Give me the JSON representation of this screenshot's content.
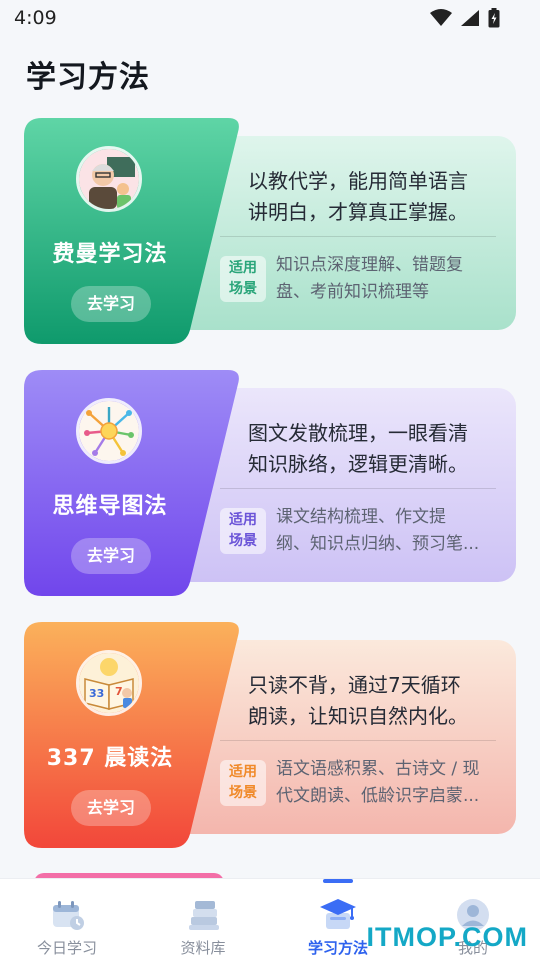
{
  "status_bar": {
    "time": "4:09"
  },
  "page": {
    "title": "学习方法"
  },
  "methods": [
    {
      "name": "费曼学习法",
      "button": "去学习",
      "desc_line1": "以教代学，能用简单语言",
      "desc_line2": "讲明白，才算真正掌握。",
      "scene_badge_1": "适用",
      "scene_badge_2": "场景",
      "scene_line1": "知识点深度理解、错题复",
      "scene_line2": "盘、考前知识梳理等",
      "accent": "#1aa77a"
    },
    {
      "name": "思维导图法",
      "button": "去学习",
      "desc_line1": "图文发散梳理，一眼看清",
      "desc_line2": "知识脉络，逻辑更清晰。",
      "scene_badge_1": "适用",
      "scene_badge_2": "场景",
      "scene_line1": "课文结构梳理、作文提",
      "scene_line2": "纲、知识点归纳、预习笔...",
      "accent": "#7b5cf0"
    },
    {
      "name": "337 晨读法",
      "button": "去学习",
      "desc_line1": "只读不背，通过7天循环",
      "desc_line2": "朗读，让知识自然内化。",
      "scene_badge_1": "适用",
      "scene_badge_2": "场景",
      "scene_line1": "语文语感积累、古诗文 / 现",
      "scene_line2": "代文朗读、低龄识字启蒙...",
      "accent": "#f26a3d"
    }
  ],
  "bottom_nav": [
    {
      "label": "今日学习",
      "icon": "calendar-icon",
      "active": false
    },
    {
      "label": "资料库",
      "icon": "books-icon",
      "active": false
    },
    {
      "label": "学习方法",
      "icon": "graduation-cap-icon",
      "active": true
    },
    {
      "label": "我的",
      "icon": "user-icon",
      "active": false
    }
  ],
  "watermark": "ITMOP.COM"
}
